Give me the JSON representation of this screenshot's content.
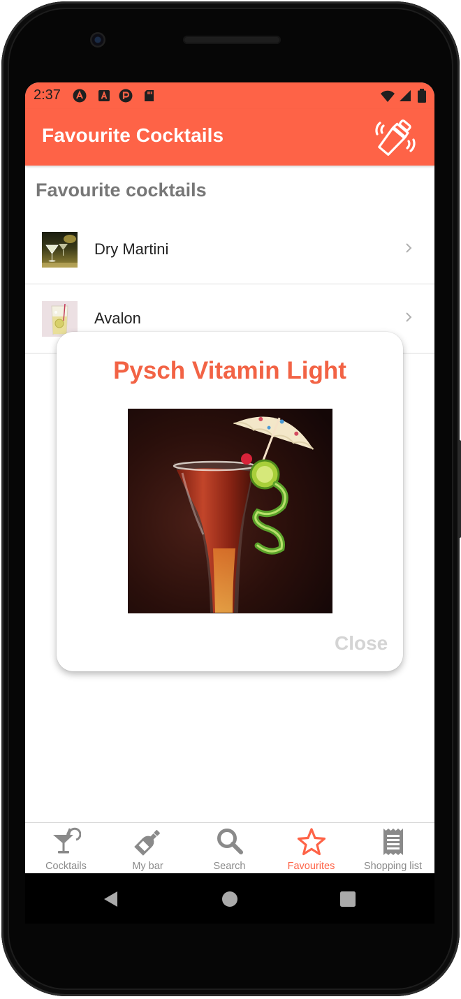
{
  "status_bar": {
    "time": "2:37",
    "left_icons": [
      "react-native-icon",
      "font-app-icon",
      "pocket-casts-icon",
      "sd-card-icon"
    ],
    "right_icons": [
      "wifi-icon",
      "signal-icon",
      "battery-icon"
    ]
  },
  "header": {
    "title": "Favourite Cocktails",
    "action_icon": "cocktail-shaker-icon"
  },
  "content": {
    "section_title": "Favourite cocktails",
    "items": [
      {
        "label": "Dry Martini",
        "thumb": "dry-martini-thumbnail"
      },
      {
        "label": "Avalon",
        "thumb": "avalon-thumbnail"
      }
    ]
  },
  "modal": {
    "title": "Pysch Vitamin Light",
    "image": "pysch-vitamin-light-photo",
    "close_label": "Close"
  },
  "tabs": [
    {
      "label": "Cocktails",
      "icon": "cocktail-glass-icon",
      "active": false
    },
    {
      "label": "My bar",
      "icon": "bottle-icon",
      "active": false
    },
    {
      "label": "Search",
      "icon": "search-icon",
      "active": false
    },
    {
      "label": "Favourites",
      "icon": "star-icon",
      "active": true
    },
    {
      "label": "Shopping list",
      "icon": "receipt-icon",
      "active": false
    }
  ],
  "colors": {
    "accent": "#fe6347",
    "modal_title": "#f26345",
    "inactive_tab": "#8a8a8a",
    "close_text": "#d4d4d4",
    "section_title": "#777777"
  },
  "system_nav": [
    "back-icon",
    "home-icon",
    "recents-icon"
  ]
}
